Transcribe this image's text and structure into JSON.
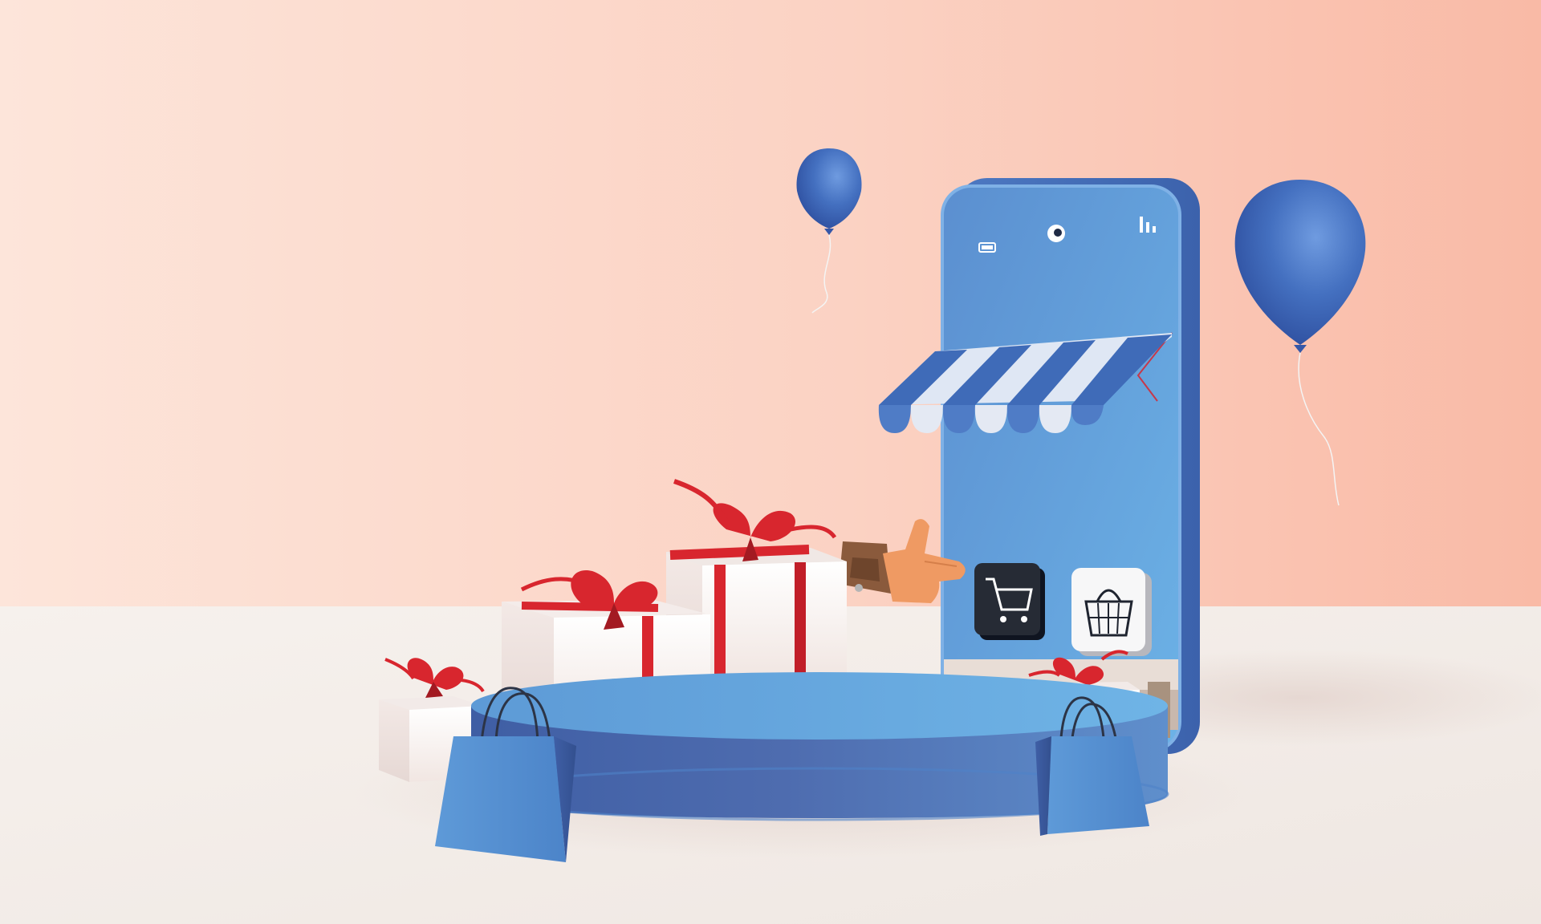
{
  "scene": {
    "kind": "illustration",
    "theme": "online shopping",
    "colors": {
      "wall_left": "#fde4d8",
      "wall_right": "#f9bca8",
      "floor": "#f3eee9",
      "phone_blue": "#5e95d3",
      "phone_body": "#4a79c4",
      "podium_top": "#64a8df",
      "podium_side": "#4a66ad",
      "balloon_blue": "#3c63b2",
      "ribbon_red": "#d8262e",
      "gift_white": "#fbf8f6",
      "hand_orange": "#ef9a63",
      "sleeve_brown": "#8a5a3c"
    },
    "icons": [
      {
        "name": "phone-icon"
      },
      {
        "name": "awning-icon"
      },
      {
        "name": "shopping-cart-icon"
      },
      {
        "name": "shopping-basket-icon"
      },
      {
        "name": "thumbs-up-icon"
      },
      {
        "name": "balloon-icon"
      },
      {
        "name": "gift-box-icon"
      },
      {
        "name": "shopping-bag-icon"
      },
      {
        "name": "podium-icon"
      },
      {
        "name": "battery-icon"
      },
      {
        "name": "signal-icon"
      },
      {
        "name": "camera-icon"
      }
    ]
  }
}
